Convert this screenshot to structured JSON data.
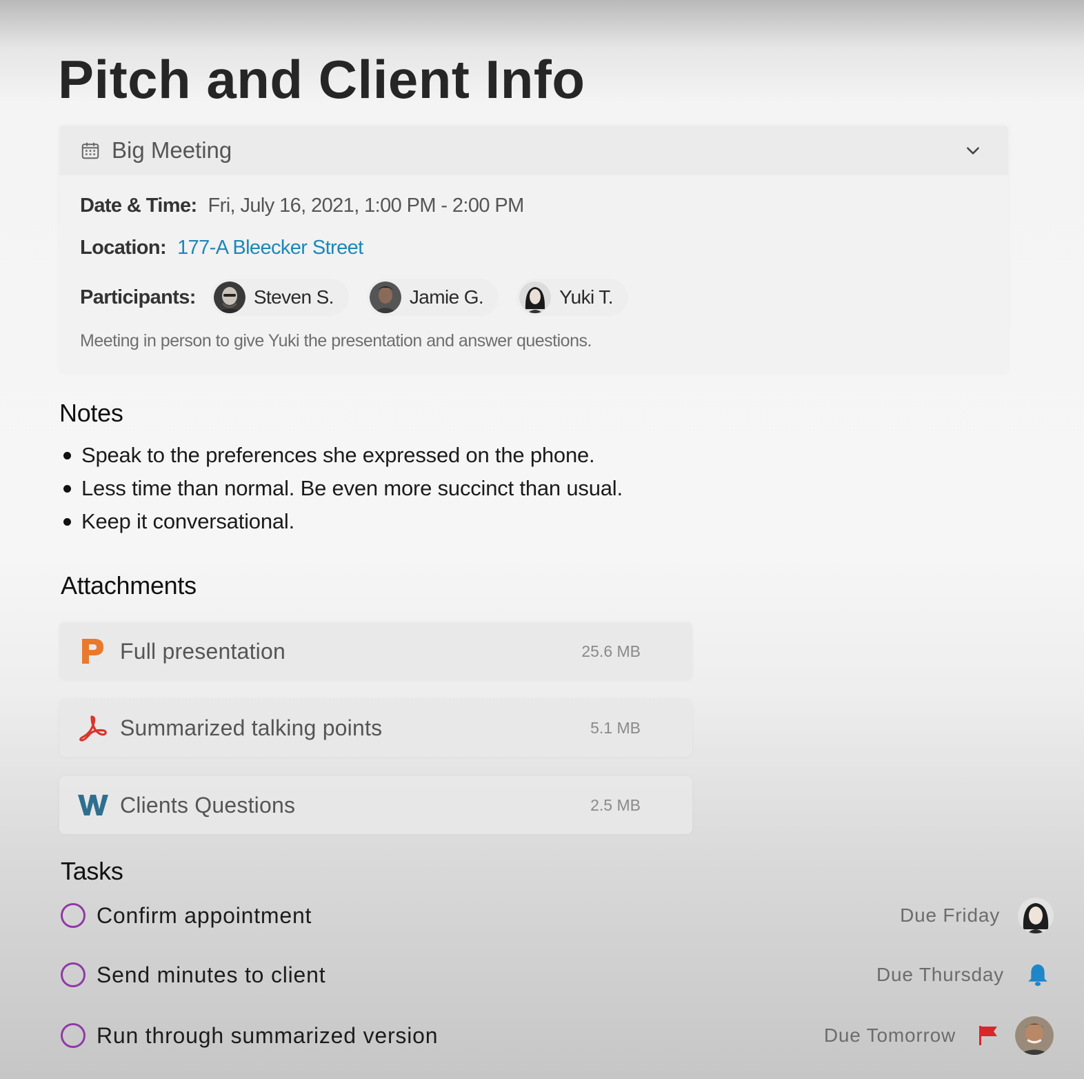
{
  "page": {
    "title": "Pitch and Client Info"
  },
  "meeting": {
    "title": "Big Meeting",
    "icon": "calendar-icon",
    "expand_icon": "chevron-down-icon",
    "datetime_label": "Date & Time:",
    "datetime_value": "Fri, July 16, 2021, 1:00 PM - 2:00 PM",
    "location_label": "Location:",
    "location_value": "177-A Bleecker Street",
    "participants_label": "Participants:",
    "participants": [
      {
        "name": "Steven S."
      },
      {
        "name": "Jamie G."
      },
      {
        "name": "Yuki T."
      }
    ],
    "description": "Meeting in person to give Yuki the presentation and answer questions."
  },
  "notes": {
    "heading": "Notes",
    "items": [
      "Speak to the preferences she expressed on the phone.",
      "Less time than normal. Be even more succinct than usual.",
      "Keep it conversational."
    ]
  },
  "attachments": {
    "heading": "Attachments",
    "items": [
      {
        "name": "Full presentation",
        "size": "25.6 MB",
        "icon": "powerpoint-icon",
        "color": "#e8792d"
      },
      {
        "name": "Summarized talking points",
        "size": "5.1 MB",
        "icon": "pdf-icon",
        "color": "#d9342b"
      },
      {
        "name": "Clients Questions",
        "size": "2.5 MB",
        "icon": "word-icon",
        "color": "#2e6f8e"
      }
    ]
  },
  "tasks": {
    "heading": "Tasks",
    "items": [
      {
        "name": "Confirm appointment",
        "due": "Due Friday"
      },
      {
        "name": "Send minutes to client",
        "due": "Due Thursday"
      },
      {
        "name": "Run through summarized version",
        "due": "Due Tomorrow"
      }
    ]
  },
  "colors": {
    "link": "#1b88b8",
    "task_circle": "#8f3aa6",
    "bell": "#1f86c9",
    "flag": "#d8262b"
  }
}
